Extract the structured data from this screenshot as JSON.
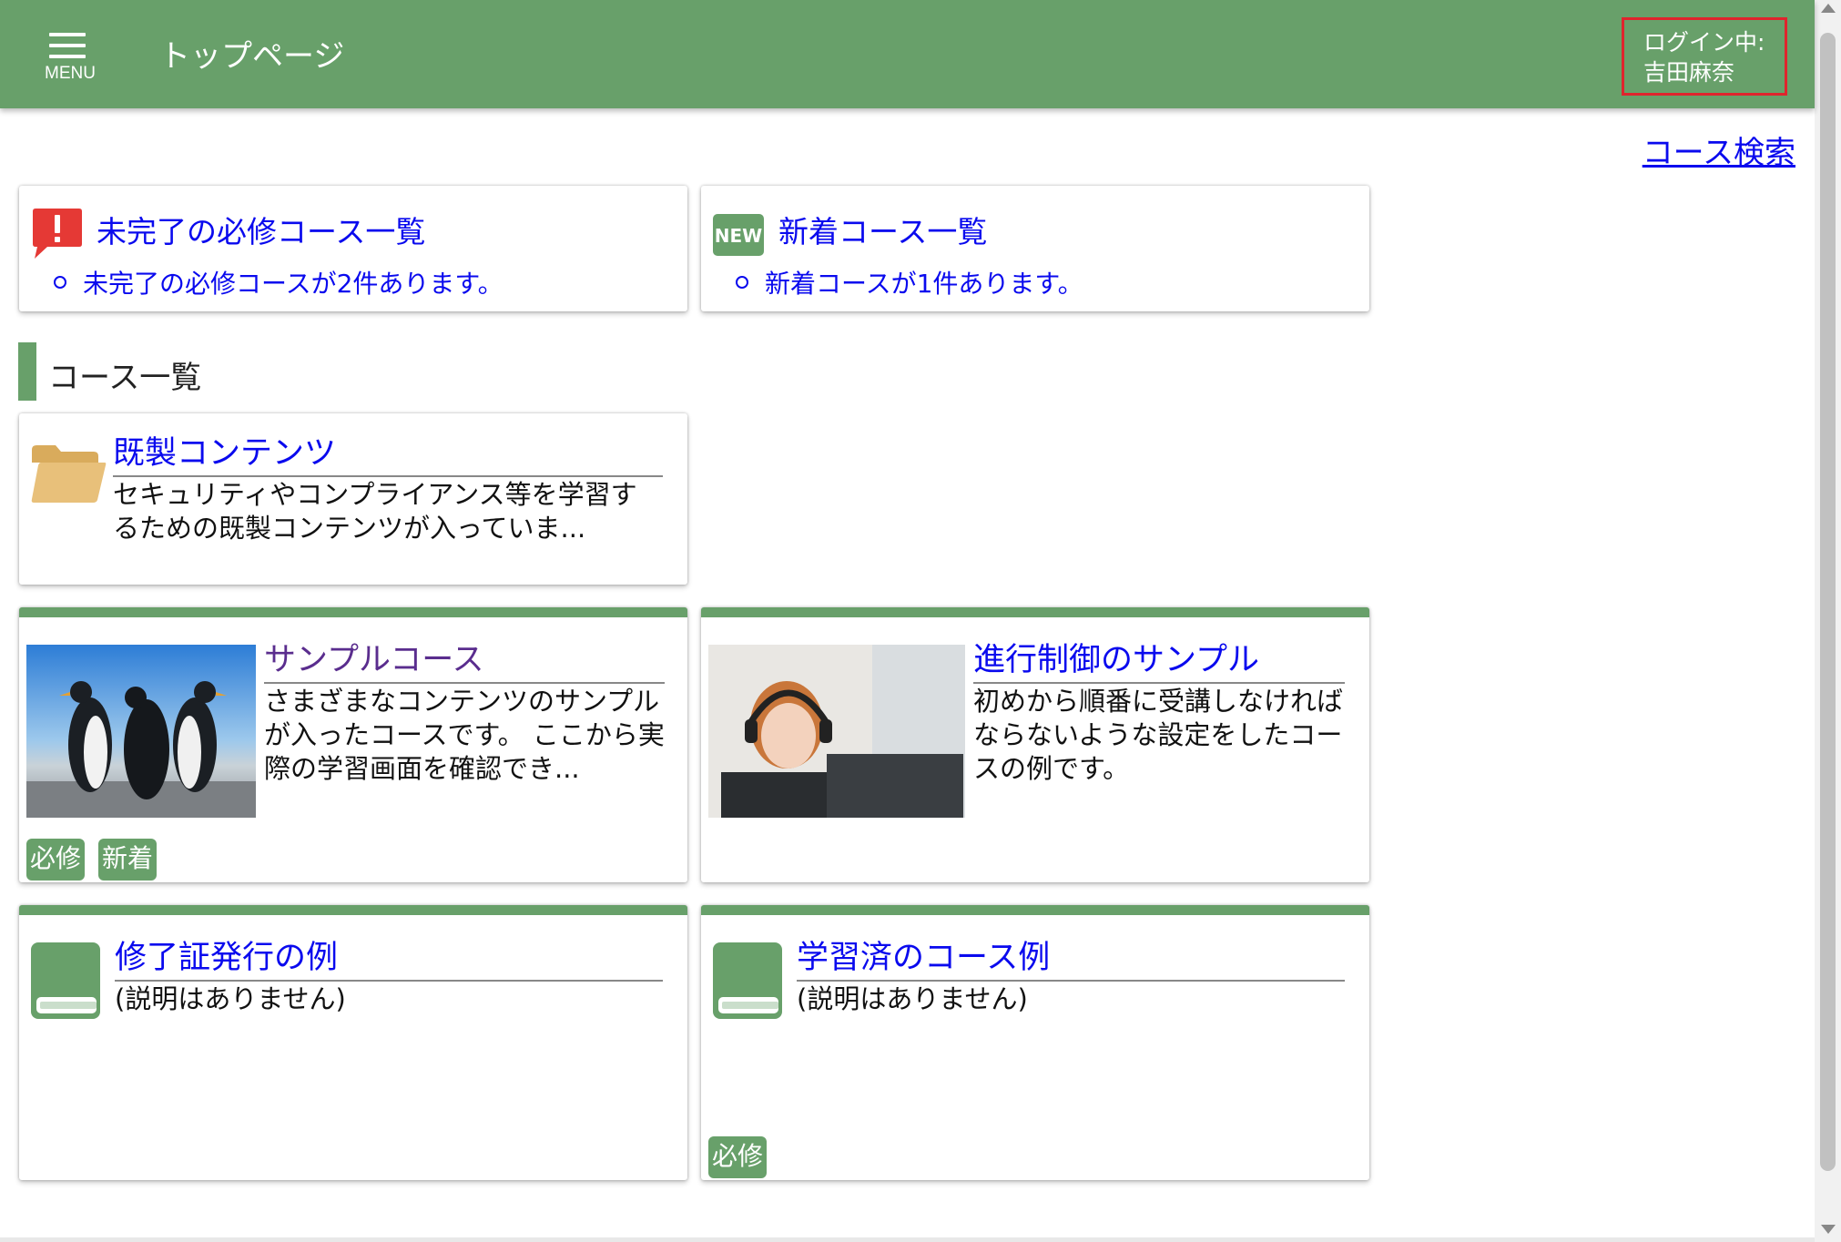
{
  "header": {
    "menu_label": "MENU",
    "page_title": "トップページ",
    "login_label": "ログイン中:",
    "login_user": "吉田麻奈"
  },
  "links": {
    "course_search": "コース検索"
  },
  "info_cards": [
    {
      "title": "未完了の必修コース一覧",
      "item": "未完了の必修コースが2件あります。",
      "icon": "alert-icon"
    },
    {
      "title": "新着コース一覧",
      "item": "新着コースが1件あります。",
      "icon": "new-badge-icon",
      "icon_text": "NEW"
    }
  ],
  "section": {
    "title": "コース一覧"
  },
  "folder": {
    "title": "既製コンテンツ",
    "description": "セキュリティやコンプライアンス等を学習するための既製コンテンツが入っていま...",
    "icon": "folder-icon"
  },
  "courses": [
    {
      "title": "サンプルコース",
      "description": "さまざまなコンテンツのサンプルが入ったコースです。 ここから実際の学習画面を確認でき...",
      "thumbnail": "penguins-photo",
      "tags": [
        "必修",
        "新着"
      ]
    },
    {
      "title": "進行制御のサンプル",
      "description": "初めから順番に受講しなければならないような設定をしたコースの例です。",
      "thumbnail": "headset-operator-photo",
      "tags": []
    },
    {
      "title": "修了証発行の例",
      "description": "(説明はありません)",
      "icon": "book-icon",
      "tags": []
    },
    {
      "title": "学習済のコース例",
      "description": "(説明はありません)",
      "icon": "book-icon",
      "tags": [
        "必修"
      ]
    }
  ],
  "colors": {
    "header_green": "#68a06a",
    "link_blue": "#0a0aee",
    "alert_red": "#e53935",
    "folder_tan": "#e8c07a",
    "login_border": "#e0242d"
  }
}
